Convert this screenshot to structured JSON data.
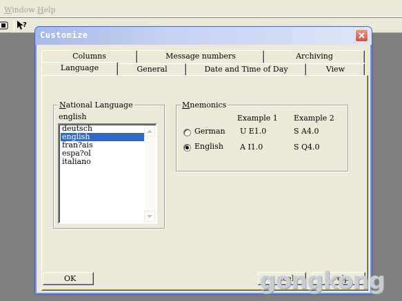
{
  "app": {
    "menu": [
      {
        "label": "Window",
        "accel": "W"
      },
      {
        "label": "Help",
        "accel": "H"
      }
    ],
    "toolbar": [
      {
        "icon": "cpu-module-icon"
      },
      {
        "icon": "help-pointer-icon",
        "glyph": "?"
      }
    ]
  },
  "dialog": {
    "title": "Customize",
    "tabs_back": [
      "Columns",
      "Message numbers",
      "Archiving"
    ],
    "tabs_front": [
      "Language",
      "General",
      "Date and Time of Day",
      "View"
    ],
    "active_tab": "Language",
    "national_language": {
      "legend_prefix": "",
      "legend_accel": "N",
      "legend_rest": "ational Language",
      "current_value": "english",
      "items": [
        "deutsch",
        "english",
        "fran?ais",
        "espa?ol",
        "italiano"
      ],
      "selected": "english"
    },
    "mnemonics": {
      "legend_accel": "M",
      "legend_rest": "nemonics",
      "example1_header": "Example 1",
      "example2_header": "Example 2",
      "rows": [
        {
          "label": "German",
          "checked": false,
          "example1": "U E1.0",
          "example2": "S A4.0"
        },
        {
          "label": "English",
          "checked": true,
          "example1": "A I1.0",
          "example2": "S Q4.0"
        }
      ]
    },
    "buttons": {
      "ok": "OK",
      "cancel_visible": "ncel",
      "help_visible": "elp"
    }
  },
  "watermark": "gongkong",
  "colors": {
    "face": "#ece9d8",
    "selection": "#316ac5",
    "titlebar_start": "#a5b9e8",
    "close_button": "#c9553c"
  }
}
